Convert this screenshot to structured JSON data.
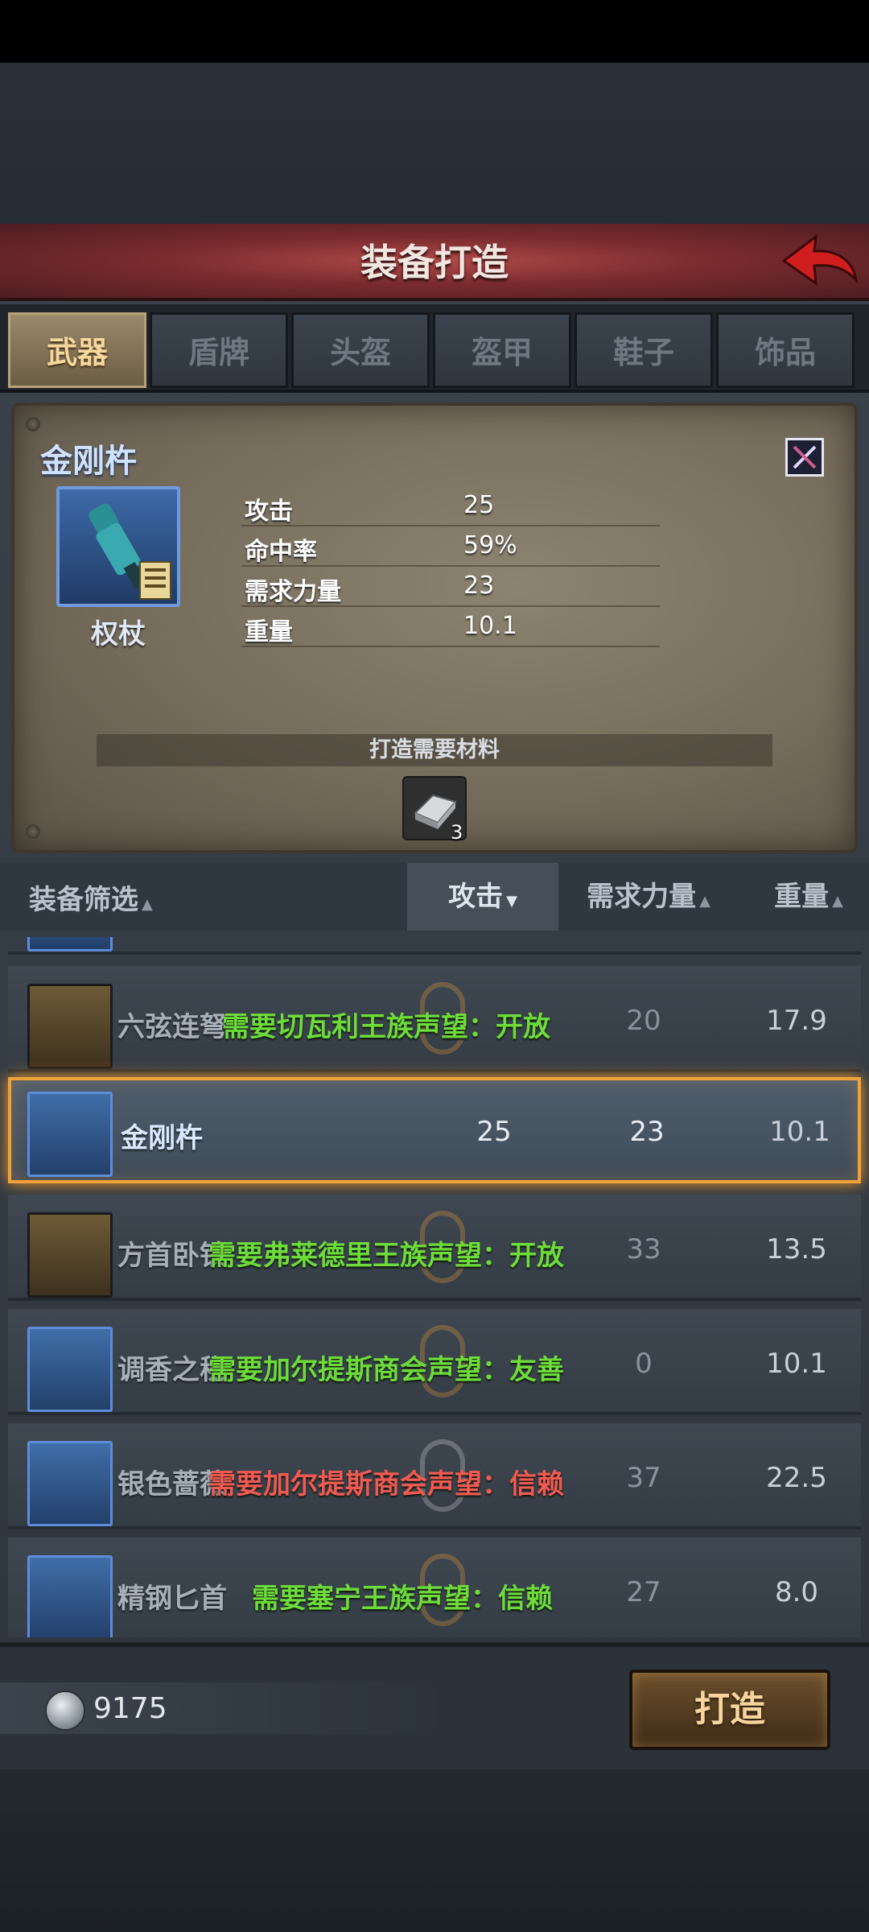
{
  "header": {
    "title": "装备打造"
  },
  "tabs": [
    {
      "label": "武器",
      "active": true
    },
    {
      "label": "盾牌",
      "active": false
    },
    {
      "label": "头盔",
      "active": false
    },
    {
      "label": "盔甲",
      "active": false
    },
    {
      "label": "鞋子",
      "active": false
    },
    {
      "label": "饰品",
      "active": false
    }
  ],
  "detail": {
    "name": "金刚杵",
    "type": "权杖",
    "stats": [
      {
        "label": "攻击",
        "value": "25"
      },
      {
        "label": "命中率",
        "value": "59%"
      },
      {
        "label": "需求力量",
        "value": "23"
      },
      {
        "label": "重量",
        "value": "10.1"
      }
    ],
    "materials_label": "打造需要材料",
    "material_count": "3"
  },
  "filter": {
    "label": "装备筛选",
    "sort_attack": "攻击",
    "sort_strength": "需求力量",
    "sort_weight": "重量"
  },
  "list": [
    {
      "name": "六弦连弩",
      "lock": "需要切瓦利王族声望：开放",
      "lock_color": "#6ddc3a",
      "attack": "",
      "strength": "20",
      "weight": "17.9",
      "icon": "gold"
    },
    {
      "name": "金刚杵",
      "lock": "",
      "attack": "25",
      "strength": "23",
      "weight": "10.1",
      "icon": "blue",
      "selected": true
    },
    {
      "name": "方首卧铁",
      "lock": "需要弗莱德里王族声望：开放",
      "lock_color": "#6ddc3a",
      "attack": "",
      "strength": "33",
      "weight": "13.5",
      "icon": "gold"
    },
    {
      "name": "调香之秘",
      "lock": "需要加尔提斯商会声望：友善",
      "lock_color": "#6ddc3a",
      "attack": "",
      "strength": "0",
      "weight": "10.1",
      "icon": "blue"
    },
    {
      "name": "银色蔷薇",
      "lock": "需要加尔提斯商会声望：信赖",
      "lock_color": "#f05a52",
      "attack": "",
      "strength": "37",
      "weight": "22.5",
      "icon": "blue"
    },
    {
      "name": "精钢匕首",
      "lock": "需要塞宁王族声望：信赖",
      "lock_color": "#6ddc3a",
      "attack": "",
      "strength": "27",
      "weight": "8.0",
      "icon": "blue"
    }
  ],
  "footer": {
    "coins": "9175",
    "craft_label": "打造"
  }
}
